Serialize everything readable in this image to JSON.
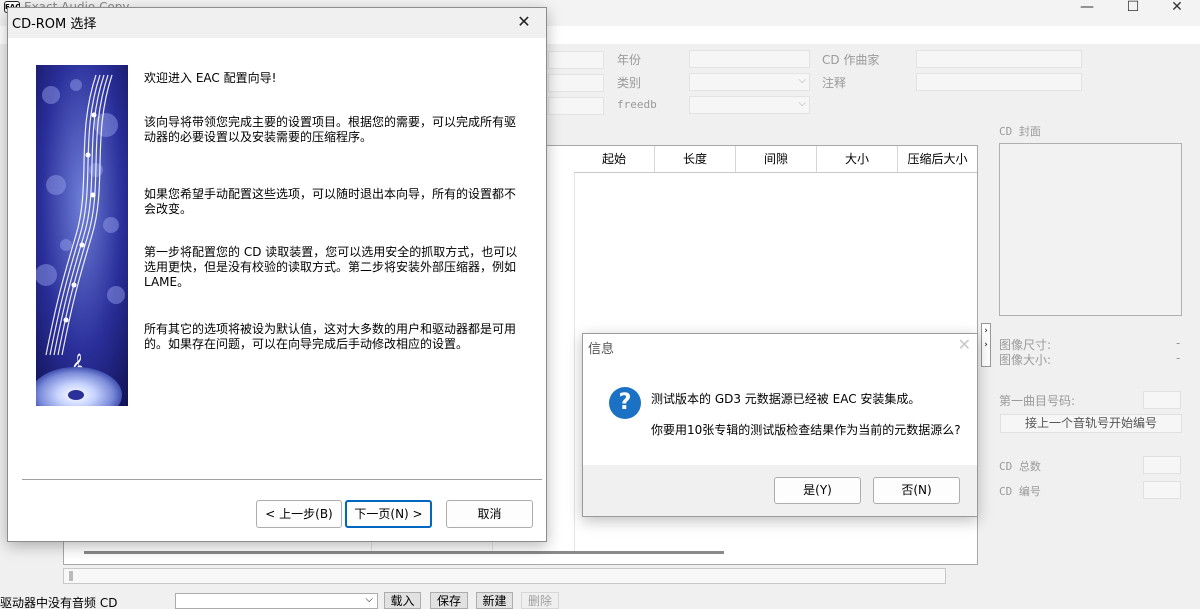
{
  "app": {
    "title": "Exact Audio Copy",
    "icon": "eac-app-icon"
  },
  "window_controls": {
    "minimize": "—",
    "maximize": "☐",
    "close": "✕"
  },
  "metadata": {
    "year_label": "年份",
    "genre_label": "类别",
    "freedb_label": "freedb",
    "composer_label": "CD 作曲家",
    "comment_label": "注释"
  },
  "track_table": {
    "columns": [
      "起始",
      "长度",
      "间隙",
      "大小",
      "压缩后大小"
    ]
  },
  "right_panel": {
    "cover_label": "CD 封面",
    "image_size_label": "图像尺寸:",
    "image_bytes_label": "图像大小:",
    "image_size_value": "-",
    "image_bytes_value": "-",
    "first_track_label": "第一曲目号码:",
    "renumber_button": "接上一个音轨号开始编号",
    "cd_total_label": "CD 总数",
    "cd_number_label": "CD 编号"
  },
  "bottom": {
    "status": "驱动器中没有音频 CD",
    "load": "载入",
    "save": "保存",
    "new": "新建",
    "delete": "删除"
  },
  "wizard": {
    "title": "CD-ROM 选择",
    "close": "✕",
    "welcome": "欢迎进入 EAC 配置向导!",
    "para1": "该向导将带领您完成主要的设置项目。根据您的需要，可以完成所有驱动器的必要设置以及安装需要的压缩程序。",
    "para2": "如果您希望手动配置这些选项，可以随时退出本向导，所有的设置都不会改变。",
    "para3": "第一步将配置您的 CD 读取装置，您可以选用安全的抓取方式，也可以选用更快，但是没有校验的读取方式。第二步将安装外部压缩器，例如 LAME。",
    "para4": "所有其它的选项将被设为默认值，这对大多数的用户和驱动器都是可用的。如果存在问题，可以在向导完成后手动修改相应的设置。",
    "back": "< 上一步(B)",
    "next": "下一页(N) >",
    "cancel": "取消"
  },
  "message_box": {
    "title": "信息",
    "close": "✕",
    "icon": "question-icon",
    "line1": "测试版本的 GD3 元数据源已经被 EAC 安装集成。",
    "line2": "你要用10张专辑的测试版检查结果作为当前的元数据源么?",
    "yes": "是(Y)",
    "no": "否(N)"
  }
}
